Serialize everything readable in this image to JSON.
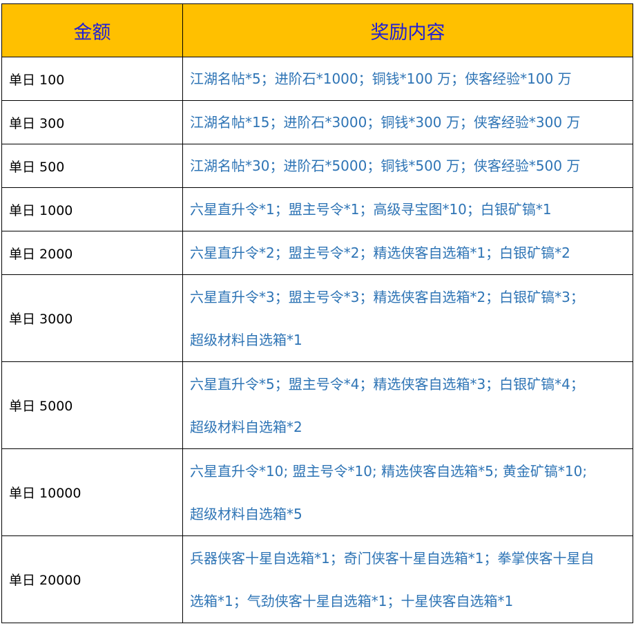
{
  "table": {
    "headers": {
      "amount": "金额",
      "reward": "奖励内容"
    },
    "rows": [
      {
        "amount": "单日 100",
        "reward": [
          "江湖名帖*5；进阶石*1000；铜钱*100 万；侠客经验*100 万"
        ]
      },
      {
        "amount": "单日 300",
        "reward": [
          "江湖名帖*15；进阶石*3000；铜钱*300 万；侠客经验*300 万"
        ]
      },
      {
        "amount": "单日 500",
        "reward": [
          "江湖名帖*30；进阶石*5000；铜钱*500 万；侠客经验*500 万"
        ]
      },
      {
        "amount": "单日 1000",
        "reward": [
          "六星直升令*1；盟主号令*1；高级寻宝图*10；白银矿镐*1"
        ]
      },
      {
        "amount": "单日 2000",
        "reward": [
          "六星直升令*2；盟主号令*2；精选侠客自选箱*1；白银矿镐*2"
        ]
      },
      {
        "amount": "单日 3000",
        "reward": [
          "六星直升令*3；盟主号令*3；精选侠客自选箱*2；白银矿镐*3；",
          "超级材料自选箱*1"
        ]
      },
      {
        "amount": "单日 5000",
        "reward": [
          "六星直升令*5；盟主号令*4；精选侠客自选箱*3；白银矿镐*4；",
          "超级材料自选箱*2"
        ]
      },
      {
        "amount": "单日 10000",
        "reward": [
          "六星直升令*10; 盟主号令*10; 精选侠客自选箱*5; 黄金矿镐*10;",
          "超级材料自选箱*5"
        ]
      },
      {
        "amount": "单日 20000",
        "reward": [
          "兵器侠客十星自选箱*1；奇门侠客十星自选箱*1；拳掌侠客十星自",
          "选箱*1；气劲侠客十星自选箱*1；十星侠客自选箱*1"
        ]
      }
    ]
  }
}
